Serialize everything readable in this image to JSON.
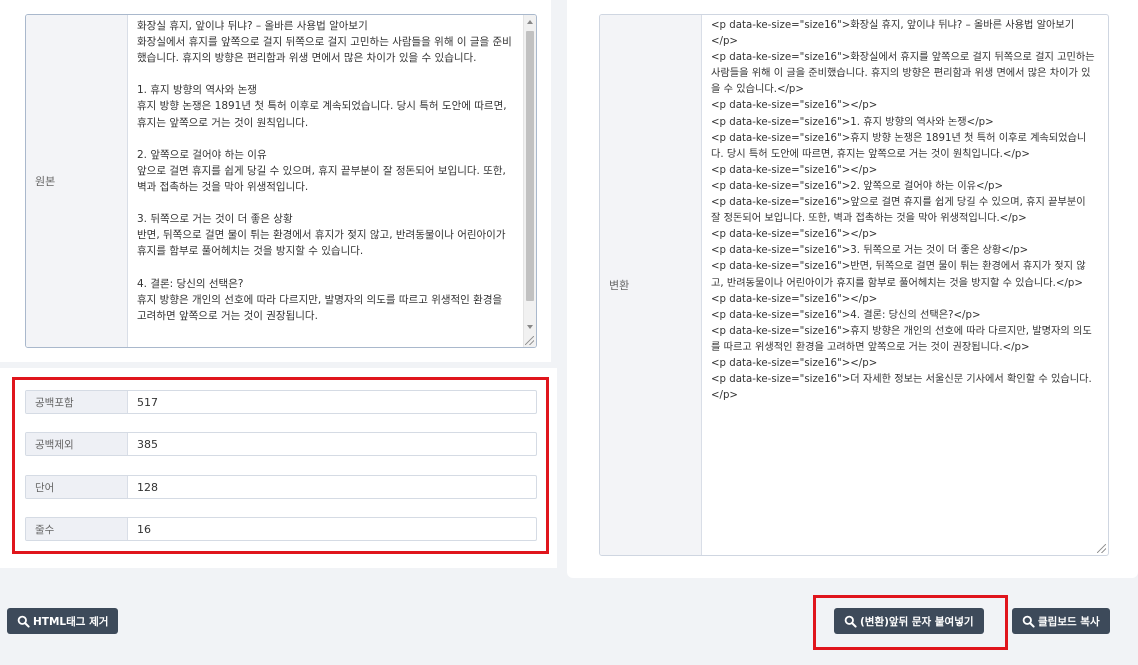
{
  "source": {
    "label": "원본",
    "text": "화장실 휴지, 앞이냐 뒤냐? – 올바른 사용법 알아보기\n화장실에서 휴지를 앞쪽으로 걸지 뒤쪽으로 걸지 고민하는 사람들을 위해 이 글을 준비했습니다. 휴지의 방향은 편리함과 위생 면에서 많은 차이가 있을 수 있습니다.\n\n1. 휴지 방향의 역사와 논쟁\n휴지 방향 논쟁은 1891년 첫 특허 이후로 계속되었습니다. 당시 특허 도안에 따르면, 휴지는 앞쪽으로 거는 것이 원칙입니다.\n\n2. 앞쪽으로 걸어야 하는 이유\n앞으로 걸면 휴지를 쉽게 당길 수 있으며, 휴지 끝부분이 잘 정돈되어 보입니다. 또한, 벽과 접촉하는 것을 막아 위생적입니다.\n\n3. 뒤쪽으로 거는 것이 더 좋은 상황\n반면, 뒤쪽으로 걸면 물이 튀는 환경에서 휴지가 젖지 않고, 반려동물이나 어린아이가 휴지를 함부로 풀어헤치는 것을 방지할 수 있습니다.\n\n4. 결론: 당신의 선택은?\n휴지 방향은 개인의 선호에 따라 다르지만, 발명자의 의도를 따르고 위생적인 환경을 고려하면 앞쪽으로 거는 것이 권장됩니다."
  },
  "converted": {
    "label": "변환",
    "text": "<p data-ke-size=\"size16\">화장실 휴지, 앞이냐 뒤냐? – 올바른 사용법 알아보기</p>\n<p data-ke-size=\"size16\">화장실에서 휴지를 앞쪽으로 걸지 뒤쪽으로 걸지 고민하는 사람들을 위해 이 글을 준비했습니다. 휴지의 방향은 편리함과 위생 면에서 많은 차이가 있을 수 있습니다.</p>\n<p data-ke-size=\"size16\"></p>\n<p data-ke-size=\"size16\">1. 휴지 방향의 역사와 논쟁</p>\n<p data-ke-size=\"size16\">휴지 방향 논쟁은 1891년 첫 특허 이후로 계속되었습니다. 당시 특허 도안에 따르면, 휴지는 앞쪽으로 거는 것이 원칙입니다.</p>\n<p data-ke-size=\"size16\"></p>\n<p data-ke-size=\"size16\">2. 앞쪽으로 걸어야 하는 이유</p>\n<p data-ke-size=\"size16\">앞으로 걸면 휴지를 쉽게 당길 수 있으며, 휴지 끝부분이 잘 정돈되어 보입니다. 또한, 벽과 접촉하는 것을 막아 위생적입니다.</p>\n<p data-ke-size=\"size16\"></p>\n<p data-ke-size=\"size16\">3. 뒤쪽으로 거는 것이 더 좋은 상황</p>\n<p data-ke-size=\"size16\">반면, 뒤쪽으로 걸면 물이 튀는 환경에서 휴지가 젖지 않고, 반려동물이나 어린아이가 휴지를 함부로 풀어헤치는 것을 방지할 수 있습니다.</p>\n<p data-ke-size=\"size16\"></p>\n<p data-ke-size=\"size16\">4. 결론: 당신의 선택은?</p>\n<p data-ke-size=\"size16\">휴지 방향은 개인의 선호에 따라 다르지만, 발명자의 의도를 따르고 위생적인 환경을 고려하면 앞쪽으로 거는 것이 권장됩니다.</p>\n<p data-ke-size=\"size16\"></p>\n<p data-ke-size=\"size16\">더 자세한 정보는 서울신문 기사에서 확인할 수 있습니다.</p>"
  },
  "stats": [
    {
      "label": "공백포함",
      "value": "517"
    },
    {
      "label": "공백제외",
      "value": "385"
    },
    {
      "label": "단어",
      "value": "128"
    },
    {
      "label": "줄수",
      "value": "16"
    }
  ],
  "buttons": {
    "strip_html": "HTML태그 제거",
    "wrap_chars": "(변환)앞뒤 문자 붙여넣기",
    "copy_clipboard": "클립보드 복사"
  },
  "colors": {
    "highlight": "#e0151c",
    "button_bg": "#3d4a5a"
  },
  "icons": {
    "button_icon": "search-icon"
  }
}
